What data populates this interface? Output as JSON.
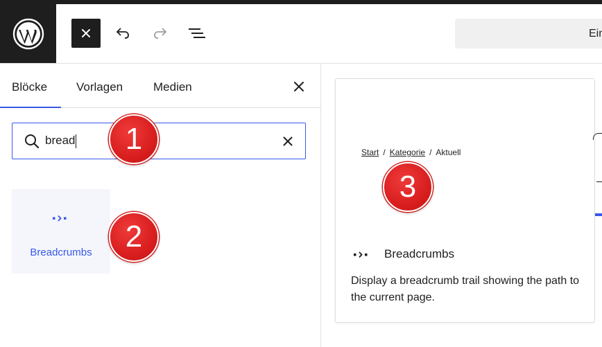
{
  "header": {
    "command_bar_text": "Ein",
    "icons": [
      "wordpress-logo",
      "close-icon",
      "undo-icon",
      "redo-icon",
      "list-view-icon"
    ]
  },
  "inserter": {
    "tabs": [
      {
        "label": "Blöcke",
        "active": true
      },
      {
        "label": "Vorlagen",
        "active": false
      },
      {
        "label": "Medien",
        "active": false
      }
    ],
    "search": {
      "value": "bread"
    },
    "results": [
      {
        "label": "Breadcrumbs",
        "icon": "breadcrumbs-icon"
      }
    ]
  },
  "preview": {
    "breadcrumb": {
      "start": "Start",
      "category": "Kategorie",
      "current": "Aktuell",
      "separator": "/"
    },
    "title": "Breadcrumbs",
    "description": "Display a breadcrumb trail showing the path to the current page."
  },
  "markers": [
    "1",
    "2",
    "3"
  ],
  "colors": {
    "accent": "#3858e9",
    "dark": "#1e1e1e",
    "marker": "#d91e1e",
    "block_bg": "#f5f6fb"
  }
}
